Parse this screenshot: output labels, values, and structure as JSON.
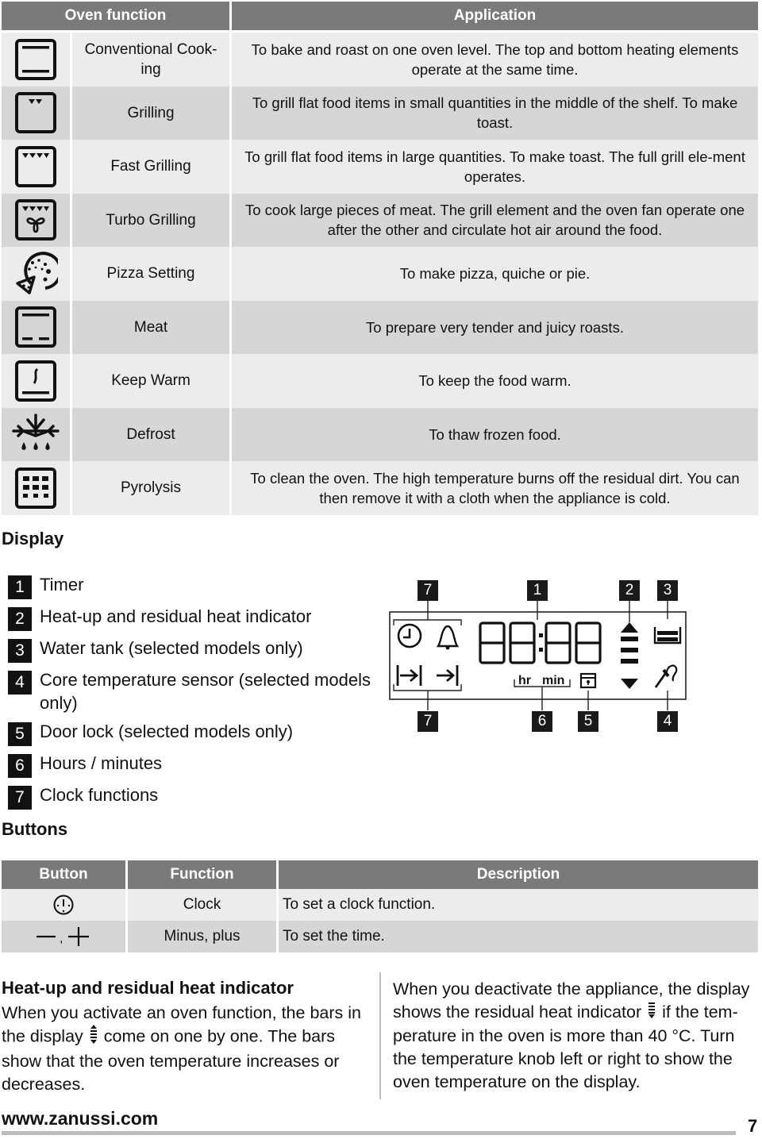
{
  "oven_table": {
    "headers": {
      "function": "Oven function",
      "application": "Application"
    },
    "rows": [
      {
        "icon": "conventional-cooking-icon",
        "name": "Conventional Cook-ing",
        "description": "To bake and roast on one oven level. The top and bottom heating elements operate at the same time."
      },
      {
        "icon": "grilling-icon",
        "name": "Grilling",
        "description": "To grill flat food items in small quantities in the middle of the shelf. To make toast."
      },
      {
        "icon": "fast-grilling-icon",
        "name": "Fast Grilling",
        "description": "To grill flat food items in large quantities. To make toast. The full grill ele-ment operates."
      },
      {
        "icon": "turbo-grilling-icon",
        "name": "Turbo Grilling",
        "description": "To cook large pieces of meat. The grill element and the oven fan operate one after the other and circulate hot air around the food."
      },
      {
        "icon": "pizza-icon",
        "name": "Pizza Setting",
        "description": "To make pizza, quiche or pie."
      },
      {
        "icon": "meat-icon",
        "name": "Meat",
        "description": "To prepare very tender and juicy roasts."
      },
      {
        "icon": "keep-warm-icon",
        "name": "Keep Warm",
        "description": "To keep the food warm."
      },
      {
        "icon": "defrost-icon",
        "name": "Defrost",
        "description": "To thaw frozen food."
      },
      {
        "icon": "pyrolysis-icon",
        "name": "Pyrolysis",
        "description": "To clean the oven. The high temperature burns off the residual dirt. You can then remove it with a cloth when the appliance is cold."
      }
    ]
  },
  "display_section": {
    "title": "Display",
    "legend": [
      {
        "num": "1",
        "label": "Timer"
      },
      {
        "num": "2",
        "label": "Heat-up and residual heat indicator"
      },
      {
        "num": "3",
        "label": "Water tank (selected models only)"
      },
      {
        "num": "4",
        "label": "Core temperature sensor (selected models only)"
      },
      {
        "num": "5",
        "label": "Door lock (selected models only)"
      },
      {
        "num": "6",
        "label": "Hours / minutes"
      },
      {
        "num": "7",
        "label": "Clock functions"
      }
    ],
    "lcd": {
      "digits": "88:88",
      "hr_label": "hr",
      "min_label": "min",
      "badges_top": [
        "7",
        "1",
        "2",
        "3"
      ],
      "badges_bottom": [
        "7",
        "6",
        "5",
        "4"
      ]
    }
  },
  "buttons_section": {
    "title": "Buttons",
    "headers": {
      "button": "Button",
      "function": "Function",
      "description": "Description"
    },
    "rows": [
      {
        "icon": "clock-button-icon",
        "symbol": "",
        "function": "Clock",
        "description": "To set a clock function."
      },
      {
        "icon": "minus-plus-icon",
        "symbol": "—, +",
        "function": "Minus, plus",
        "description": "To set the time."
      }
    ]
  },
  "heat_indicator": {
    "title": "Heat-up and residual heat indicator",
    "left_para_a": "When you activate an oven function, the bars in the display",
    "left_para_b": "come on one by one. The bars show that the oven temperature increases or decreases.",
    "right_para_a": "When you deactivate the appliance, the display shows the residual heat indicator",
    "right_para_b": "if the tem-perature in the oven is more than 40 °C. Turn the temperature knob left or right to show the oven temperature on the display."
  },
  "footer": {
    "url": "www.zanussi.com",
    "page": "7"
  }
}
